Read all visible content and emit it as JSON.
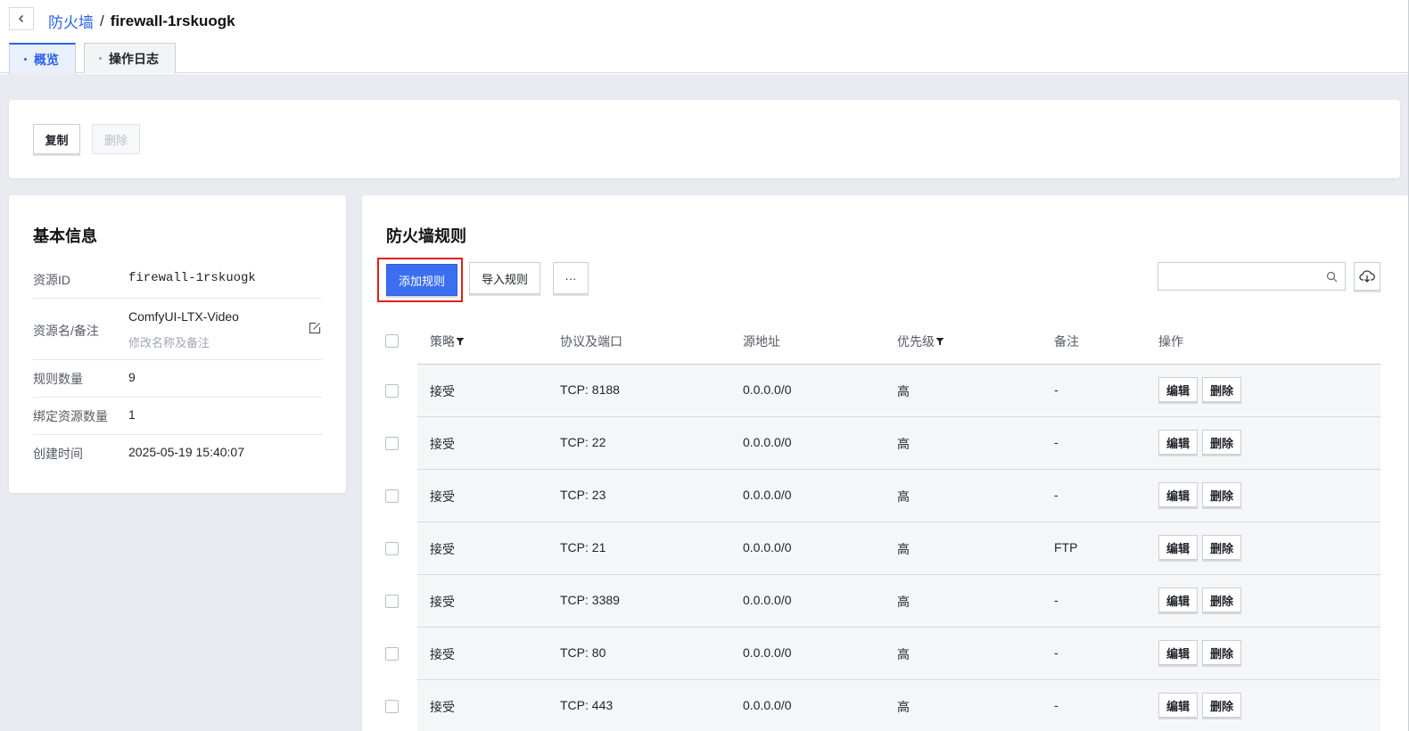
{
  "breadcrumb": {
    "parent": "防火墙",
    "separator": "/",
    "current": "firewall-1rskuogk"
  },
  "tabs": [
    {
      "label": "概览",
      "active": true
    },
    {
      "label": "操作日志",
      "active": false
    }
  ],
  "toolbar": {
    "copy_label": "复制",
    "delete_label": "删除"
  },
  "basic_info": {
    "title": "基本信息",
    "rows": [
      {
        "label": "资源ID",
        "value": "firewall-1rskuogk"
      },
      {
        "label": "资源名/备注",
        "value": "ComfyUI-LTX-Video",
        "hint": "修改名称及备注"
      },
      {
        "label": "规则数量",
        "value": "9"
      },
      {
        "label": "绑定资源数量",
        "value": "1"
      },
      {
        "label": "创建时间",
        "value": "2025-05-19 15:40:07"
      }
    ]
  },
  "rules": {
    "title": "防火墙规则",
    "add_label": "添加规则",
    "import_label": "导入规则",
    "more_label": "···",
    "search_placeholder": "",
    "columns": [
      "策略",
      "协议及端口",
      "源地址",
      "优先级",
      "备注",
      "操作"
    ],
    "edit_label": "编辑",
    "delete_label": "删除",
    "rows": [
      {
        "policy": "接受",
        "proto": "TCP: 8188",
        "src": "0.0.0.0/0",
        "priority": "高",
        "note": "-"
      },
      {
        "policy": "接受",
        "proto": "TCP: 22",
        "src": "0.0.0.0/0",
        "priority": "高",
        "note": "-"
      },
      {
        "policy": "接受",
        "proto": "TCP: 23",
        "src": "0.0.0.0/0",
        "priority": "高",
        "note": "-"
      },
      {
        "policy": "接受",
        "proto": "TCP: 21",
        "src": "0.0.0.0/0",
        "priority": "高",
        "note": "FTP"
      },
      {
        "policy": "接受",
        "proto": "TCP: 3389",
        "src": "0.0.0.0/0",
        "priority": "高",
        "note": "-"
      },
      {
        "policy": "接受",
        "proto": "TCP: 80",
        "src": "0.0.0.0/0",
        "priority": "高",
        "note": "-"
      },
      {
        "policy": "接受",
        "proto": "TCP: 443",
        "src": "0.0.0.0/0",
        "priority": "高",
        "note": "-"
      }
    ]
  },
  "colors": {
    "accent": "#3b6ef0",
    "link": "#2a62e8",
    "highlight_border": "#e0201e",
    "page_bg": "#e9ebf0"
  }
}
